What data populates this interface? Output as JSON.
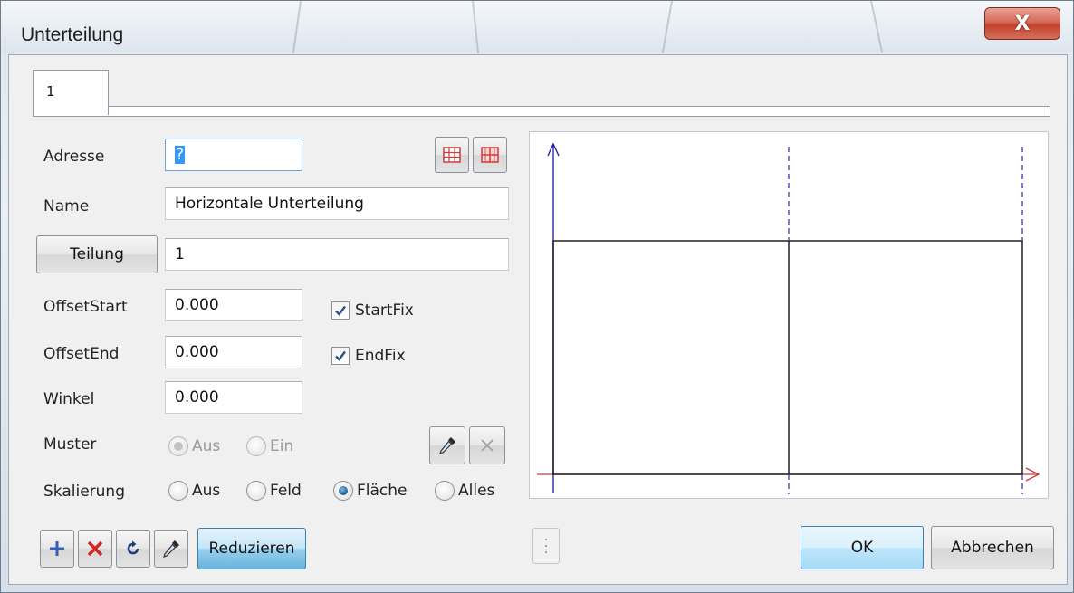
{
  "window": {
    "title": "Unterteilung",
    "close_glyph": "X"
  },
  "tabs": [
    {
      "label": "1",
      "active": true
    }
  ],
  "form": {
    "adresse_label": "Adresse",
    "adresse_value": "?",
    "name_label": "Name",
    "name_value": "Horizontale Unterteilung",
    "teilung_button": "Teilung",
    "teilung_value": "1",
    "offset_start_label": "OffsetStart",
    "offset_start_value": "0.000",
    "offset_end_label": "OffsetEnd",
    "offset_end_value": "0.000",
    "winkel_label": "Winkel",
    "winkel_value": "0.000",
    "startfix_label": "StartFix",
    "startfix_checked": true,
    "endfix_label": "EndFix",
    "endfix_checked": true,
    "muster_label": "Muster",
    "muster_options": [
      "Aus",
      "Ein"
    ],
    "muster_selected": "Aus",
    "skalierung_label": "Skalierung",
    "skalierung_options": [
      "Aus",
      "Feld",
      "Fläche",
      "Alles"
    ],
    "skalierung_selected": "Fläche"
  },
  "icons": {
    "grid_icon_1": "grid-icon",
    "grid_icon_2": "grid-split-icon",
    "eyedropper": "eyedropper-icon",
    "clear": "close-icon",
    "add": "plus-icon",
    "delete": "delete-icon",
    "reset": "refresh-icon",
    "pick": "eyedropper-icon",
    "grip": "vertical-grip-icon"
  },
  "toolbar": {
    "reduzieren_label": "Reduzieren"
  },
  "footer": {
    "ok_label": "OK",
    "cancel_label": "Abbrechen"
  },
  "colors": {
    "axis_blue": "#1a1aa6",
    "axis_red": "#d23a3a",
    "divider_dash": "#3a3ab4",
    "plus_blue": "#2f5fb8",
    "delete_red": "#d42424",
    "grid_red": "#d23a3a"
  }
}
